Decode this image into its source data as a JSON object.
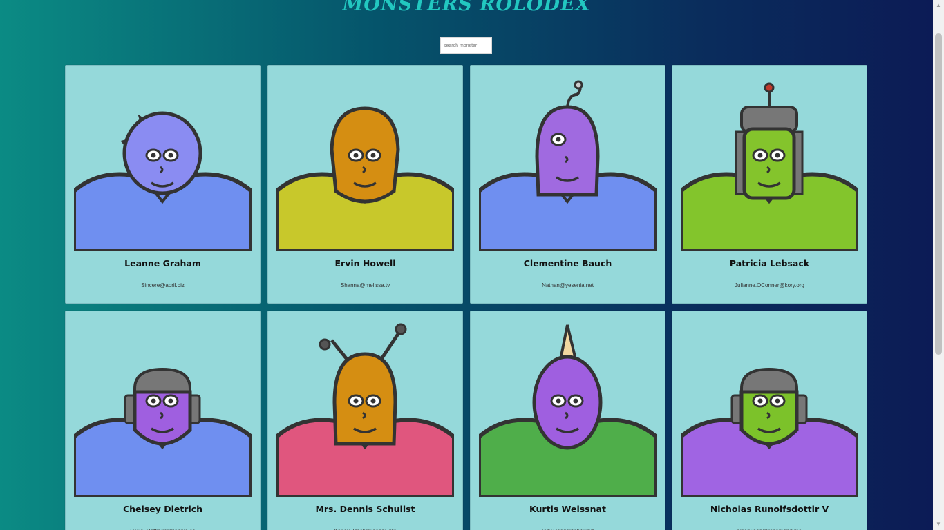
{
  "app": {
    "title": "MONSTERS ROLODEX"
  },
  "search": {
    "placeholder": "search monster"
  },
  "monsters": [
    {
      "name": "Leanne Graham",
      "email": "Sincere@april.biz",
      "skin": "#8a8cf2",
      "body": "#6f8ff0",
      "head": "horns"
    },
    {
      "name": "Ervin Howell",
      "email": "Shanna@melissa.tv",
      "skin": "#d58e12",
      "body": "#c8c82b",
      "head": "hood"
    },
    {
      "name": "Clementine Bauch",
      "email": "Nathan@yesenia.net",
      "skin": "#a06ae0",
      "body": "#6f8ff0",
      "head": "cyclops"
    },
    {
      "name": "Patricia Lebsack",
      "email": "Julianne.OConner@kory.org",
      "skin": "#84c42c",
      "body": "#83c52c",
      "head": "helmet"
    },
    {
      "name": "Chelsey Dietrich",
      "email": "Lucio_Hettinger@annie.ca",
      "skin": "#9f5fe0",
      "body": "#6f8ff0",
      "head": "robot"
    },
    {
      "name": "Mrs. Dennis Schulist",
      "email": "Karley_Dach@jasper.info",
      "skin": "#d58e12",
      "body": "#e0567e",
      "head": "antenna"
    },
    {
      "name": "Kurtis Weissnat",
      "email": "Telly.Hoeger@billy.biz",
      "skin": "#9f5fe0",
      "body": "#4fae4a",
      "head": "horn"
    },
    {
      "name": "Nicholas Runolfsdottir V",
      "email": "Sherwood@rosamond.me",
      "skin": "#7cc22a",
      "body": "#a064e3",
      "head": "robot"
    }
  ],
  "scrollbar": {
    "up_arrow": "▲",
    "down_arrow": "▼"
  }
}
